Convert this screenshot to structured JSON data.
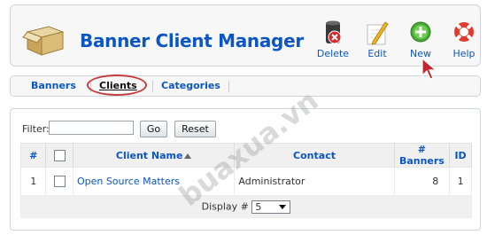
{
  "header": {
    "title": "Banner Client Manager"
  },
  "toolbar": {
    "delete_label": "Delete",
    "edit_label": "Edit",
    "new_label": "New",
    "help_label": "Help"
  },
  "subnav": {
    "banners": "Banners",
    "clients": "Clients",
    "categories": "Categories"
  },
  "filter": {
    "label": "Filter:",
    "value": "",
    "go_label": "Go",
    "reset_label": "Reset"
  },
  "table": {
    "headers": {
      "num": "#",
      "name": "Client Name",
      "contact": "Contact",
      "banners": "# Banners",
      "id": "ID"
    },
    "rows": [
      {
        "num": "1",
        "name": "Open Source Matters",
        "contact": "Administrator",
        "banners": "8",
        "id": "1"
      }
    ]
  },
  "footer": {
    "display_label": "Display #",
    "display_value": "5"
  },
  "watermark": "buaxua.vn",
  "colors": {
    "link": "#0b55c4",
    "highlight_ring": "#c43c3c"
  }
}
